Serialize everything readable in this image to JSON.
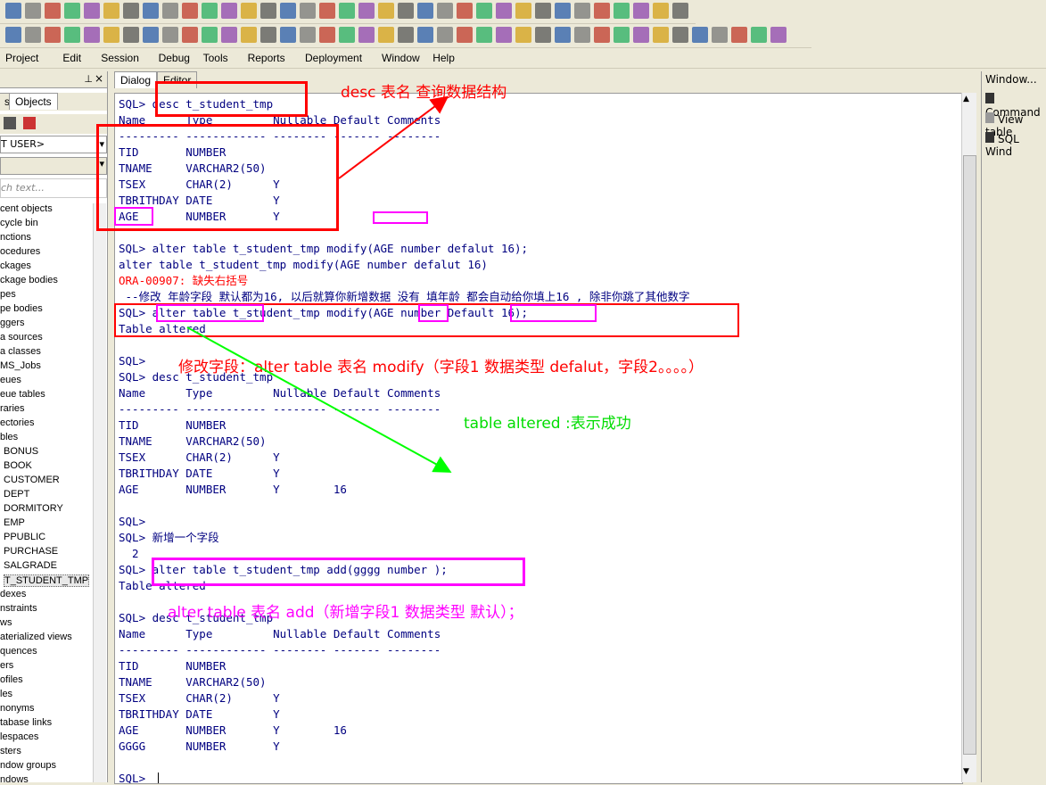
{
  "menu": [
    "Project",
    "Edit",
    "Session",
    "Debug",
    "Tools",
    "Reports",
    "Deployment",
    "Window",
    "Help"
  ],
  "left": {
    "tabs": [
      "s",
      "Objects"
    ],
    "user": "T USER>",
    "search_placeholder": "ch text...",
    "tree": [
      "cent objects",
      "cycle bin",
      "nctions",
      "ocedures",
      "ckages",
      "ckage bodies",
      "pes",
      "pe bodies",
      "ggers",
      "a sources",
      "a classes",
      "MS_Jobs",
      "eues",
      "eue tables",
      "raries",
      "ectories",
      "bles",
      "BONUS",
      "BOOK",
      "CUSTOMER",
      "DEPT",
      "DORMITORY",
      "EMP",
      "PPUBLIC",
      "PURCHASE",
      "SALGRADE",
      "T_STUDENT_TMP",
      "dexes",
      "nstraints",
      "ws",
      "aterialized views",
      "quences",
      "ers",
      "ofiles",
      "les",
      "nonyms",
      "tabase links",
      "lespaces",
      "sters",
      "ndow groups",
      "ndows"
    ]
  },
  "main_tabs": [
    "Dialog",
    "Editor"
  ],
  "right": {
    "title": "Window...",
    "items": [
      "Command",
      "View table",
      "SQL Wind"
    ]
  },
  "lines": [
    {
      "t": "SQL> desc t_student_tmp",
      "c": "n"
    },
    {
      "t": "Name      Type         Nullable Default Comments",
      "c": "n"
    },
    {
      "t": "--------- ------------ -------- ------- --------",
      "c": "n"
    },
    {
      "t": "TID       NUMBER",
      "c": "n"
    },
    {
      "t": "TNAME     VARCHAR2(50)",
      "c": "n"
    },
    {
      "t": "TSEX      CHAR(2)      Y",
      "c": "n"
    },
    {
      "t": "TBRITHDAY DATE         Y",
      "c": "n"
    },
    {
      "t": "AGE       NUMBER       Y",
      "c": "n"
    },
    {
      "t": "",
      "c": "n"
    },
    {
      "t": "SQL> alter table t_student_tmp modify(AGE number defalut 16);",
      "c": "n"
    },
    {
      "t": "alter table t_student_tmp modify(AGE number defalut 16)",
      "c": "n"
    },
    {
      "t": "ORA-00907: 缺失右括号",
      "c": "r"
    },
    {
      "t": " --修改 年龄字段 默认都为16, 以后就算你新增数据 没有 填年龄 都会自动给你填上16 , 除非你跳了其他数字",
      "c": "n"
    },
    {
      "t": "SQL> alter table t_student_tmp modify(AGE number Default 16);",
      "c": "n"
    },
    {
      "t": "Table altered",
      "c": "n"
    },
    {
      "t": "",
      "c": "n"
    },
    {
      "t": "SQL>",
      "c": "n"
    },
    {
      "t": "SQL> desc t_student_tmp",
      "c": "n"
    },
    {
      "t": "Name      Type         Nullable Default Comments",
      "c": "n"
    },
    {
      "t": "--------- ------------ -------- ------- --------",
      "c": "n"
    },
    {
      "t": "TID       NUMBER",
      "c": "n"
    },
    {
      "t": "TNAME     VARCHAR2(50)",
      "c": "n"
    },
    {
      "t": "TSEX      CHAR(2)      Y",
      "c": "n"
    },
    {
      "t": "TBRITHDAY DATE         Y",
      "c": "n"
    },
    {
      "t": "AGE       NUMBER       Y        16",
      "c": "n"
    },
    {
      "t": "",
      "c": "n"
    },
    {
      "t": "SQL>",
      "c": "n"
    },
    {
      "t": "SQL> 新增一个字段",
      "c": "n"
    },
    {
      "t": "  2",
      "c": "n"
    },
    {
      "t": "SQL> alter table t_student_tmp add(gggg number );",
      "c": "n"
    },
    {
      "t": "Table altered",
      "c": "n"
    },
    {
      "t": "",
      "c": "n"
    },
    {
      "t": "SQL> desc t_student_tmp",
      "c": "n"
    },
    {
      "t": "Name      Type         Nullable Default Comments",
      "c": "n"
    },
    {
      "t": "--------- ------------ -------- ------- --------",
      "c": "n"
    },
    {
      "t": "TID       NUMBER",
      "c": "n"
    },
    {
      "t": "TNAME     VARCHAR2(50)",
      "c": "n"
    },
    {
      "t": "TSEX      CHAR(2)      Y",
      "c": "n"
    },
    {
      "t": "TBRITHDAY DATE         Y",
      "c": "n"
    },
    {
      "t": "AGE       NUMBER       Y        16",
      "c": "n"
    },
    {
      "t": "GGGG      NUMBER       Y",
      "c": "n"
    },
    {
      "t": "",
      "c": "n"
    },
    {
      "t": "SQL> ",
      "c": "n"
    }
  ],
  "annotations": {
    "a1": "desc 表名 查询数据结构",
    "a2": "修改字段：alter table 表名 modify（字段1 数据类型 defalut，字段2。。。。）",
    "a3": "table altered :表示成功",
    "a4": "alter table 表名 add（新增字段1 数据类型 默认）；"
  },
  "colors": {
    "red": "#ff0000",
    "magenta": "#ff00ff",
    "green": "#00ff00",
    "text": "#000080"
  }
}
